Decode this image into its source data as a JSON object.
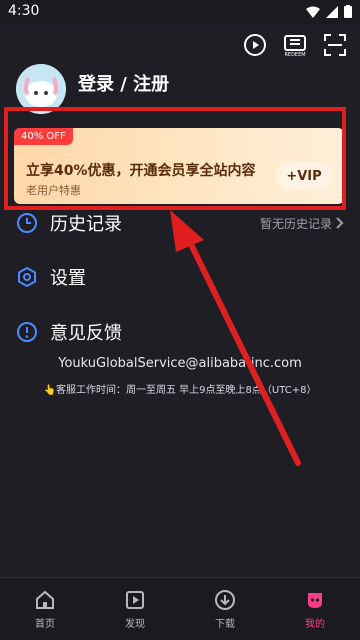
{
  "status_bar": {
    "time": "4:30"
  },
  "header": {
    "login_label": "登录 / 注册",
    "icons": [
      "video-history-icon",
      "redeem-icon",
      "scan-icon"
    ],
    "redeem_label": "REDEEM"
  },
  "vip_banner": {
    "badge": "40% OFF",
    "headline": "立享40%优惠，开通会员享全站内容",
    "subtext": "老用户特惠",
    "button_label": "+VIP"
  },
  "menu": {
    "items": [
      {
        "label": "历史记录",
        "right_text": "暂无历史记录",
        "icon": "clock-icon"
      },
      {
        "label": "设置",
        "icon": "settings-icon"
      },
      {
        "label": "意见反馈",
        "icon": "feedback-icon"
      }
    ]
  },
  "support": {
    "email": "YoukuGlobalService@alibaba-inc.com",
    "hours": "👆客服工作时间：周一至周五 早上9点至晚上8点（UTC+8）"
  },
  "bottom_nav": {
    "items": [
      {
        "label": "首页",
        "icon": "home-icon"
      },
      {
        "label": "发现",
        "icon": "discover-icon"
      },
      {
        "label": "下载",
        "icon": "download-icon"
      },
      {
        "label": "我的",
        "icon": "profile-icon",
        "active": true
      }
    ]
  },
  "colors": {
    "accent_pink": "#ff3d8a",
    "vip_gold": "#ffd7a8",
    "badge_red": "#ff3b3b",
    "highlight_red": "#e02020",
    "menu_icon_blue": "#4b8bff"
  }
}
